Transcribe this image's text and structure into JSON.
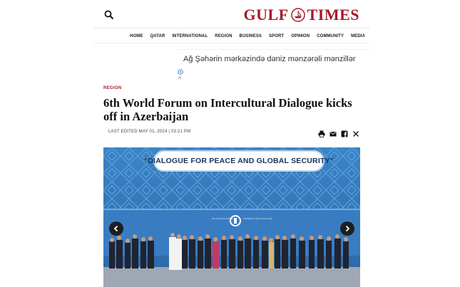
{
  "header": {
    "logo_left": "GULF",
    "logo_right": "TIMES"
  },
  "nav": {
    "items": [
      "HOME",
      "QATAR",
      "INTERNATIONAL",
      "REGION",
      "BUSINESS",
      "SPORT",
      "OPINION",
      "COMMUNITY",
      "MEDIA"
    ]
  },
  "ad": {
    "text": "Ağ Şəhərin mərkəzində dəniz mənzərəli mənzillər"
  },
  "article": {
    "section": "REGION",
    "headline": "6th World Forum on Intercultural Dialogue kicks off in Azerbaijan",
    "dateline": "LAST EDITED MAY 01, 2024 | 03:21 PM"
  },
  "photo": {
    "banner_text": "“DIALOGUE FOR PEACE AND GLOBAL SECURITY”"
  },
  "colors": {
    "brand": "#a8192b",
    "photo_blue": "#2f6fb1"
  },
  "icons": [
    "search-icon",
    "print-icon",
    "email-icon",
    "facebook-icon",
    "x-icon",
    "chevron-left-icon",
    "chevron-right-icon"
  ]
}
